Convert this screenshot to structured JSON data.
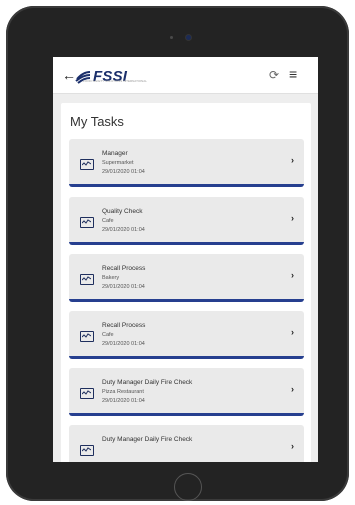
{
  "header": {
    "back_glyph": "←",
    "logo_text": "FSSI",
    "logo_tagline": "FOOD SAFETY SOLUTIONS INTERNATIONAL",
    "refresh_glyph": "⟳",
    "menu_glyph": "≡"
  },
  "page": {
    "title": "My Tasks"
  },
  "tasks": [
    {
      "title": "Manager",
      "location": "Supermarket",
      "date": "29/01/2020 01:04"
    },
    {
      "title": "Quality Check",
      "location": "Cafe",
      "date": "29/01/2020 01:04"
    },
    {
      "title": "Recall Process",
      "location": "Bakery",
      "date": "29/01/2020 01:04"
    },
    {
      "title": "Recall Process",
      "location": "Cafe",
      "date": "29/01/2020 01:04"
    },
    {
      "title": "Duty Manager Daily Fire Check",
      "location": "Pizza Restaurant",
      "date": "29/01/2020 01:04"
    },
    {
      "title": "Duty Manager Daily Fire Check",
      "location": "",
      "date": ""
    }
  ],
  "chevron_glyph": "›",
  "icons": {
    "task": "chart-monitor-icon",
    "back": "back-arrow-icon",
    "refresh": "refresh-icon",
    "menu": "hamburger-menu-icon"
  },
  "colors": {
    "accent": "#263f8f",
    "logo": "#1b2f6b",
    "card": "#eaeaea",
    "bg": "#eeeeee"
  }
}
